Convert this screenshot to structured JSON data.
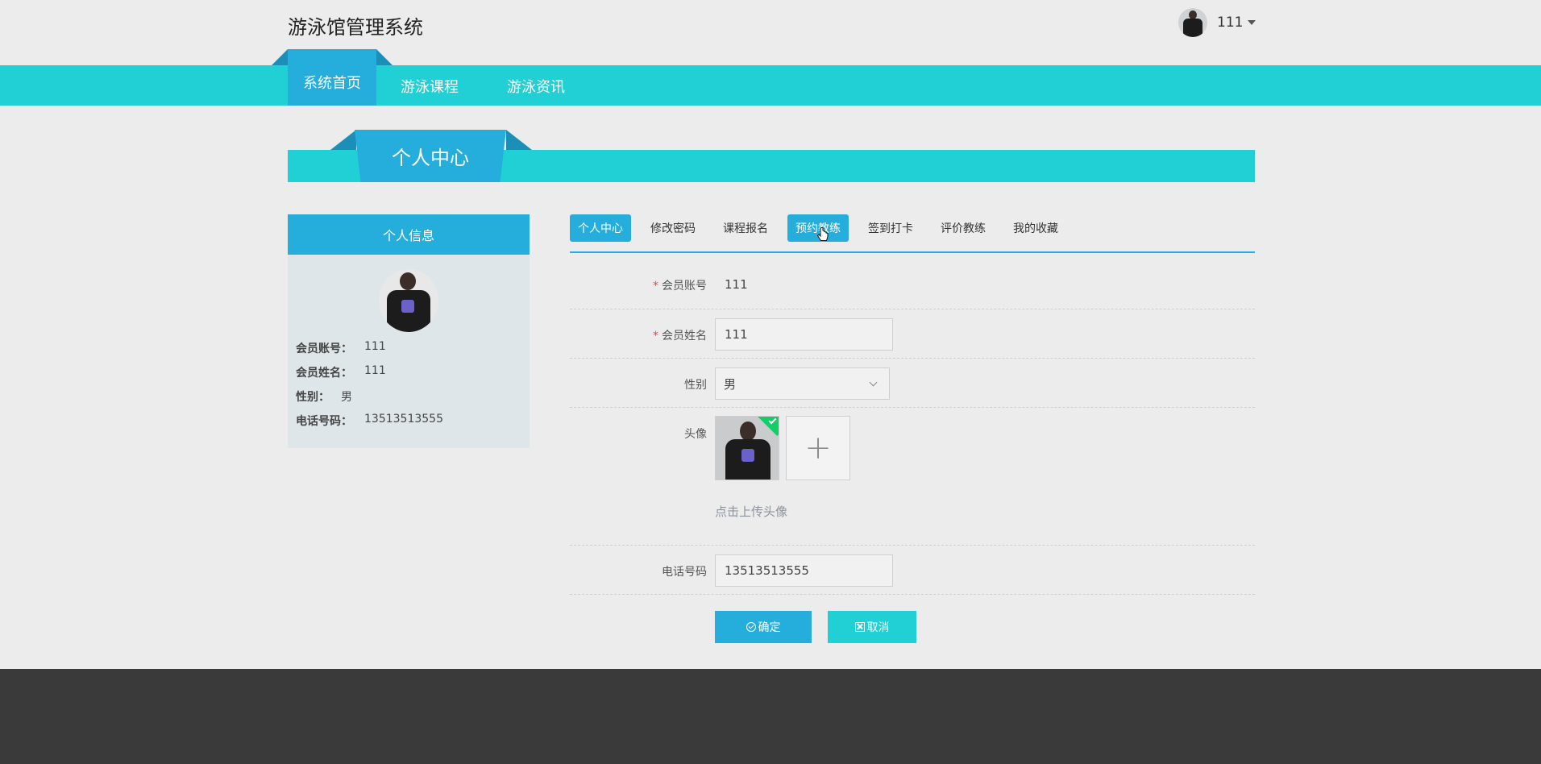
{
  "header": {
    "site_title": "游泳馆管理系统",
    "user_name": "111"
  },
  "nav": {
    "items": [
      {
        "label": "系统首页"
      },
      {
        "label": "游泳课程"
      },
      {
        "label": "游泳资讯"
      }
    ]
  },
  "banner": {
    "title": "个人中心"
  },
  "info_card": {
    "title": "个人信息",
    "rows": [
      {
        "label": "会员账号：",
        "value": "111"
      },
      {
        "label": "会员姓名：",
        "value": "111"
      },
      {
        "label": "性别：",
        "value": "男"
      },
      {
        "label": "电话号码：",
        "value": "13513513555"
      }
    ]
  },
  "tabs": [
    {
      "label": "个人中心"
    },
    {
      "label": "修改密码"
    },
    {
      "label": "课程报名"
    },
    {
      "label": "预约教练"
    },
    {
      "label": "签到打卡"
    },
    {
      "label": "评价教练"
    },
    {
      "label": "我的收藏"
    }
  ],
  "form": {
    "account": {
      "label": "会员账号",
      "value": "111",
      "required": "*"
    },
    "name": {
      "label": "会员姓名",
      "value": "111",
      "required": "*"
    },
    "gender": {
      "label": "性别",
      "value": "男"
    },
    "avatar": {
      "label": "头像",
      "add": "+",
      "tip": "点击上传头像"
    },
    "phone": {
      "label": "电话号码",
      "value": "13513513555"
    },
    "confirm": "确定",
    "cancel": "取消"
  },
  "colors": {
    "primary": "#25aedb",
    "accent": "#20d0d5",
    "footer": "#3a3a3a"
  }
}
